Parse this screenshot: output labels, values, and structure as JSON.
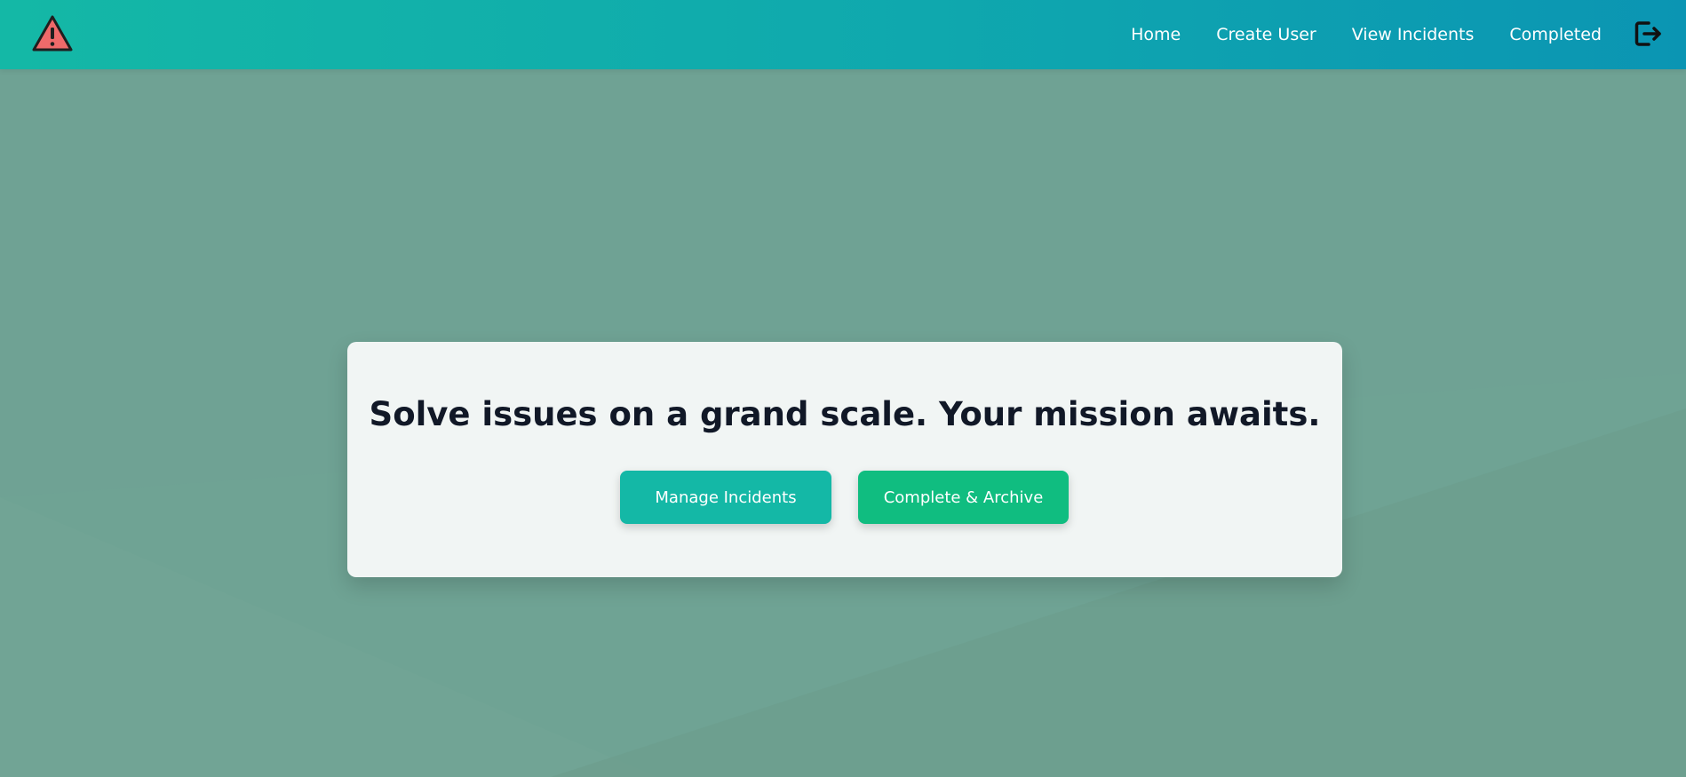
{
  "navbar": {
    "logo_icon": "warning-triangle-icon",
    "links": [
      {
        "label": "Home"
      },
      {
        "label": "Create User"
      },
      {
        "label": "View Incidents"
      },
      {
        "label": "Completed"
      }
    ],
    "logout_icon": "logout-icon"
  },
  "hero": {
    "title": "Solve issues on a grand scale. Your mission awaits.",
    "buttons": {
      "manage_label": "Manage Incidents",
      "complete_label": "Complete & Archive"
    }
  },
  "colors": {
    "navbar_start": "#14b8a6",
    "navbar_end": "#0b95b3",
    "background": "#6fa394",
    "card": "#f1f5f4",
    "manage_button": "#14b8a6",
    "complete_button": "#10bd80",
    "title_text": "#111827"
  }
}
